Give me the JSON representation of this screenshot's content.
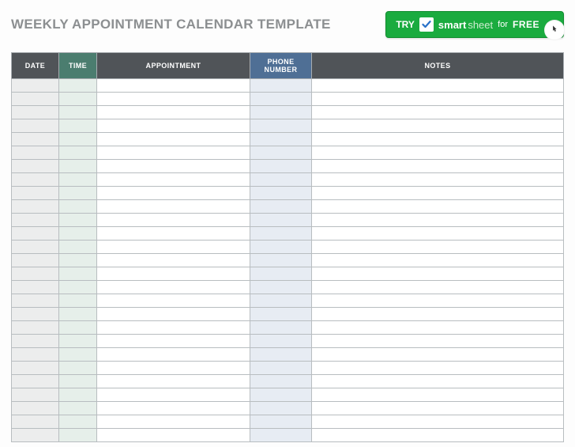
{
  "title": "WEEKLY APPOINTMENT CALENDAR TEMPLATE",
  "cta": {
    "try": "TRY",
    "brand1": "smart",
    "brand2": "sheet",
    "for": "for",
    "free": "FREE"
  },
  "columns": {
    "date": "DATE",
    "time": "TIME",
    "appointment": "APPOINTMENT",
    "phone": "PHONE NUMBER",
    "notes": "NOTES"
  },
  "row_count": 27
}
